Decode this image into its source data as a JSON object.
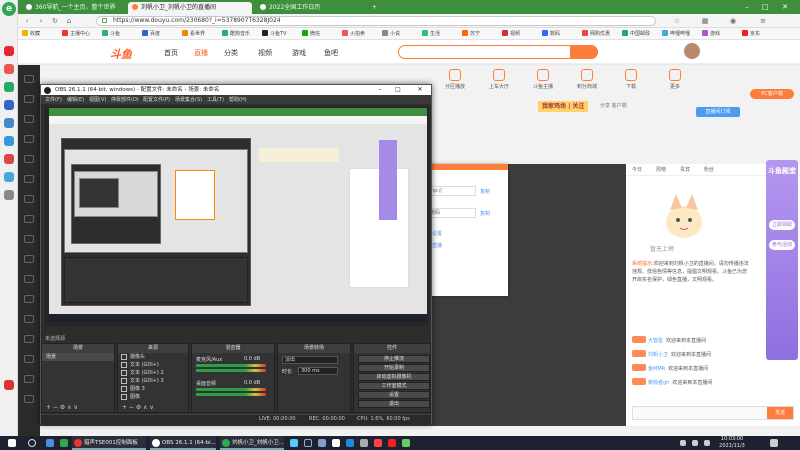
{
  "browser": {
    "tabs": [
      {
        "label": "360导航_一个主页，整个世界"
      },
      {
        "label": "刘帆小卫_刘帆小卫的直播间"
      },
      {
        "label": "2022全国工作日历"
      }
    ],
    "url": "https://www.douyu.com/230680?_i=5378907T6328J024",
    "bookmarks": [
      "收藏",
      "主播中心",
      "斗鱼",
      "百度",
      "看世界",
      "酷狗音乐",
      "斗鱼TV",
      "微信",
      "火拍卖",
      "小说",
      "生活",
      "苏宁",
      "视频",
      "数码",
      "网购优惠",
      "中国邮政",
      "哔哩哔哩",
      "游戏",
      "京东"
    ]
  },
  "douyu": {
    "logo": "斗鱼",
    "nav": [
      "首页",
      "直播",
      "分类",
      "视频",
      "游戏",
      "鱼吧"
    ],
    "top_icons": [
      "分区播放",
      "上车大厅",
      "斗鱼主播",
      "积分商城",
      "下载",
      "更多"
    ],
    "pc_button": "PC客户端",
    "room_title": "我家鸡场 | 关注",
    "room_ops": "分享  客户端",
    "subscribe": "直播间订阅",
    "rank_tabs": [
      "今日",
      "周榜",
      "贵宾",
      "粉丝"
    ],
    "mascot_text": "暂无上榜",
    "system_msg_label": "系统提示:",
    "system_msg": "欢迎来到刘帆小卫的直播间，请勿传播违法违规、低俗色情等信息，提倡文明观看。斗鱼已为您开启实名保护，绿色直播，文明观看。",
    "chat": [
      {
        "nick": "大智星",
        "text": "欢迎来到本直播间"
      },
      {
        "nick": "刘帆小卫",
        "text": "欢迎来到本直播间"
      },
      {
        "nick": "鱼MMR",
        "text": "欢迎来到本直播间"
      },
      {
        "nick": "旁观者gh",
        "text": "欢迎来到本直播间"
      }
    ],
    "chat_send": "发送",
    "promo_title": "斗鱼殿堂",
    "promo_pills": [
      "立即领取",
      "参与活动"
    ],
    "popup": {
      "field1": "rtmp://",
      "field2": "推流码",
      "copy1": "复制",
      "copy2": "复制",
      "link1": "推流设置",
      "link2": "开始直播"
    }
  },
  "obs": {
    "title": "OBS 26.1.1 (64-bit, windows) - 配置文件: 未命名 - 场景: 未命名",
    "menu": [
      "文件(F)",
      "编辑(E)",
      "视图(V)",
      "停靠部件(D)",
      "配置文件(P)",
      "场景集合(S)",
      "工具(T)",
      "帮助(H)"
    ],
    "scene_label": "未选择源",
    "docks": {
      "scenes": {
        "title": "场景",
        "items": [
          "场景"
        ]
      },
      "sources": {
        "title": "来源",
        "items": [
          "摄像头",
          "文本 (GDI+)",
          "文本 (GDI+) 2",
          "文本 (GDI+) 3",
          "图像 3",
          "图像"
        ]
      },
      "mixer": {
        "title": "混音器",
        "ch1": "麦克风/Aux",
        "ch1_db": "0.0 dB",
        "ch2": "桌面音频",
        "ch2_db": "0.0 dB"
      },
      "transitions": {
        "title": "场景转场",
        "type": "淡出",
        "duration_label": "时长",
        "duration": "300 ms"
      },
      "controls": {
        "title": "控件",
        "buttons": [
          "停止推流",
          "开始录制",
          "启动虚拟摄像机",
          "工作室模式",
          "设置",
          "退出"
        ]
      }
    },
    "status": {
      "live": "LIVE: 00:00:00",
      "rec": "REC: 00:00:00",
      "cpu": "CPU: 1.6%, 60.00 fps"
    }
  },
  "taskbar": {
    "apps": [
      "猎声TSE001控制面板",
      "OBS 26.1.1 (64-bi...",
      "刘帆小卫_刘帆小卫..."
    ],
    "time": "10:03:00",
    "date": "2021/11/3"
  },
  "colors": {
    "douyu_orange": "#ff7d3b",
    "browser_green": "#3d8f3d",
    "obs_dark": "#2d2d2d"
  }
}
